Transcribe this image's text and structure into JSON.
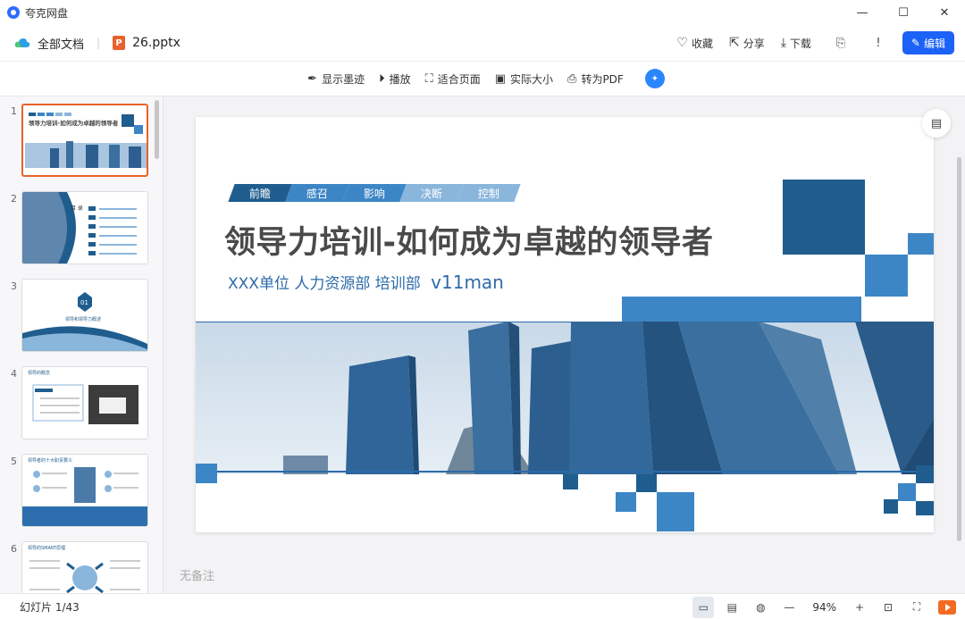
{
  "app": {
    "title": "夸克网盘"
  },
  "window": {
    "minimize": "—",
    "maximize": "☐",
    "close": "✕"
  },
  "header": {
    "all_docs": "全部文档",
    "file_icon_letter": "P",
    "file_name": "26.pptx",
    "actions": {
      "favorite": "收藏",
      "share": "分享",
      "download": "下载",
      "edit": "编辑"
    }
  },
  "toolbar": {
    "ink": "显示墨迹",
    "play": "播放",
    "fit_page": "适合页面",
    "actual_size": "实际大小",
    "to_pdf": "转为PDF"
  },
  "sidebar": {
    "slide_numbers": [
      "1",
      "2",
      "3",
      "4",
      "5",
      "6"
    ],
    "thumb_texts": {
      "t1_title": "领导力培训-如何成为卓越的领导者",
      "t2_heading": "目 录",
      "t3_badge": "01",
      "t3_caption": "领导和领导力概述",
      "t4_heading": "领导的概念",
      "t5_heading": "领导者的十大职责要义",
      "t6_heading": "领导的SMART原理"
    }
  },
  "slide": {
    "tags": [
      "前瞻",
      "感召",
      "影响",
      "决断",
      "控制"
    ],
    "title": "领导力培训-如何成为卓越的领导者",
    "subtitle": "XXX单位  人力资源部 培训部",
    "author": "v11man",
    "colors": {
      "dark": "#1f5d8e",
      "mid": "#3d86c6",
      "light": "#8bb6dc",
      "building": "#2c5f8f"
    }
  },
  "notes": "无备注",
  "status": {
    "slide_count": "幻灯片 1/43",
    "zoom": "94%"
  }
}
